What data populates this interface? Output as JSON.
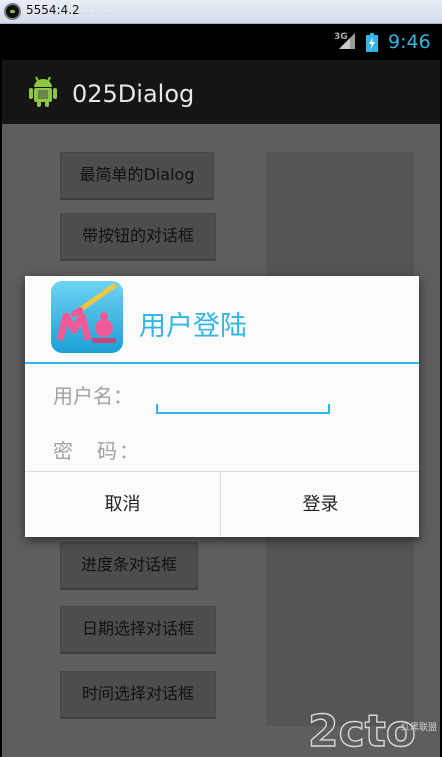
{
  "window": {
    "title": "5554:4.2",
    "ghost_text": "... .. ..."
  },
  "status_bar": {
    "network": "3G",
    "time": "9:46"
  },
  "action_bar": {
    "app_title": "025Dialog",
    "icon": "android-robot-icon"
  },
  "buttons": [
    {
      "label": "最简单的Dialog"
    },
    {
      "label": "带按钮的对话框"
    },
    {
      "label": "进度条对话框"
    },
    {
      "label": "日期选择对话框"
    },
    {
      "label": "时间选择对话框"
    }
  ],
  "dialog": {
    "title": "用户登陆",
    "icon": "paint-brush-m-icon",
    "username_label": "用户名：",
    "username_value": "",
    "password_label": "密　码：",
    "password_value": "",
    "cancel_label": "取消",
    "login_label": "登录"
  },
  "watermark": {
    "text": "2cto",
    "subtext": "红黑联盟"
  },
  "colors": {
    "accent": "#33b5e5",
    "dim_background": "#5e5e5e"
  }
}
